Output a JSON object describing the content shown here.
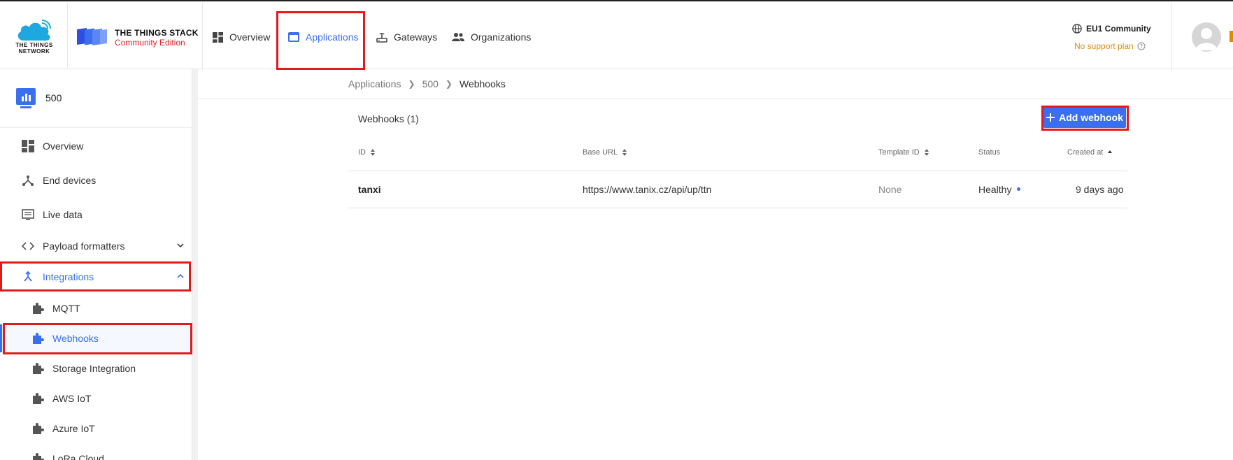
{
  "header": {
    "ttn_logo_text": [
      "THE THINGS",
      "NETWORK"
    ],
    "stack_title": "THE THINGS STACK",
    "stack_subtitle": "Community Edition",
    "nav": [
      {
        "label": "Overview",
        "icon": "dashboard-icon"
      },
      {
        "label": "Applications",
        "icon": "application-window-icon",
        "active": true
      },
      {
        "label": "Gateways",
        "icon": "router-icon"
      },
      {
        "label": "Organizations",
        "icon": "people-icon"
      }
    ],
    "region": "EU1 Community",
    "support": "No support plan"
  },
  "sidebar": {
    "app_name": "500",
    "items": [
      {
        "label": "Overview",
        "icon": "dashboard-icon"
      },
      {
        "label": "End devices",
        "icon": "device-tree-icon"
      },
      {
        "label": "Live data",
        "icon": "monitor-list-icon"
      },
      {
        "label": "Payload formatters",
        "icon": "code-icon",
        "expandable": true
      },
      {
        "label": "Integrations",
        "icon": "merge-icon",
        "expanded": true,
        "active": true
      }
    ],
    "sub_items": [
      {
        "label": "MQTT",
        "icon": "puzzle-icon"
      },
      {
        "label": "Webhooks",
        "icon": "puzzle-icon",
        "active": true
      },
      {
        "label": "Storage Integration",
        "icon": "puzzle-icon"
      },
      {
        "label": "AWS IoT",
        "icon": "puzzle-icon"
      },
      {
        "label": "Azure IoT",
        "icon": "puzzle-icon"
      },
      {
        "label": "LoRa Cloud",
        "icon": "puzzle-icon"
      }
    ]
  },
  "breadcrumb": [
    "Applications",
    "500",
    "Webhooks"
  ],
  "webhooks": {
    "title": "Webhooks (1)",
    "add_button": "Add webhook",
    "columns": [
      "ID",
      "Base URL",
      "Template ID",
      "Status",
      "Created at"
    ],
    "rows": [
      {
        "id": "tanxi",
        "base_url": "https://www.tanix.cz/api/up/ttn",
        "template_id": "None",
        "status": "Healthy",
        "created_at": "9 days ago"
      }
    ]
  },
  "colors": {
    "accent": "#3a6ff0",
    "highlight": "#e01b1b",
    "support": "#d98a1a"
  }
}
